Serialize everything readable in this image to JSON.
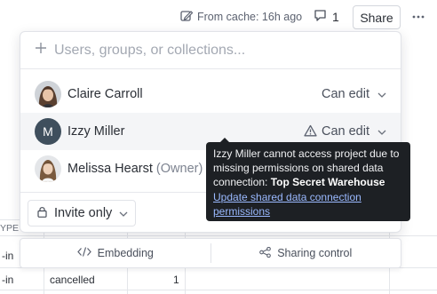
{
  "header": {
    "cache_label": "From cache: 16h ago",
    "comment_count": "1",
    "share_label": "Share"
  },
  "share_panel": {
    "search_placeholder": "Users, groups, or collections...",
    "members": [
      {
        "name": "Claire Carroll",
        "role_suffix": "",
        "permission": "Can edit",
        "avatar": "photo"
      },
      {
        "name": "Izzy Miller",
        "role_suffix": "",
        "permission": "Can edit",
        "avatar": "M",
        "warning": true
      },
      {
        "name": "Melissa Hearst",
        "role_suffix": "(Owner)",
        "permission": "",
        "avatar": "photo"
      }
    ],
    "invite_setting": "Invite only"
  },
  "tooltip": {
    "message": "Izzy Miller cannot access project due to missing permissions on shared data connection: ",
    "connection_name": "Top Secret Warehouse",
    "link_text": "Update shared data connection permissions"
  },
  "bottom_tabs": [
    {
      "label": "Embedding",
      "icon": "code-icon"
    },
    {
      "label": "Sharing control",
      "icon": "share-nodes-icon"
    }
  ],
  "background_table": {
    "header_fragment": "YPE",
    "rows": [
      {
        "col1": "-in",
        "col2": "",
        "col3": ""
      },
      {
        "col1": "-in",
        "col2": "cancelled",
        "col3": "1"
      }
    ]
  }
}
